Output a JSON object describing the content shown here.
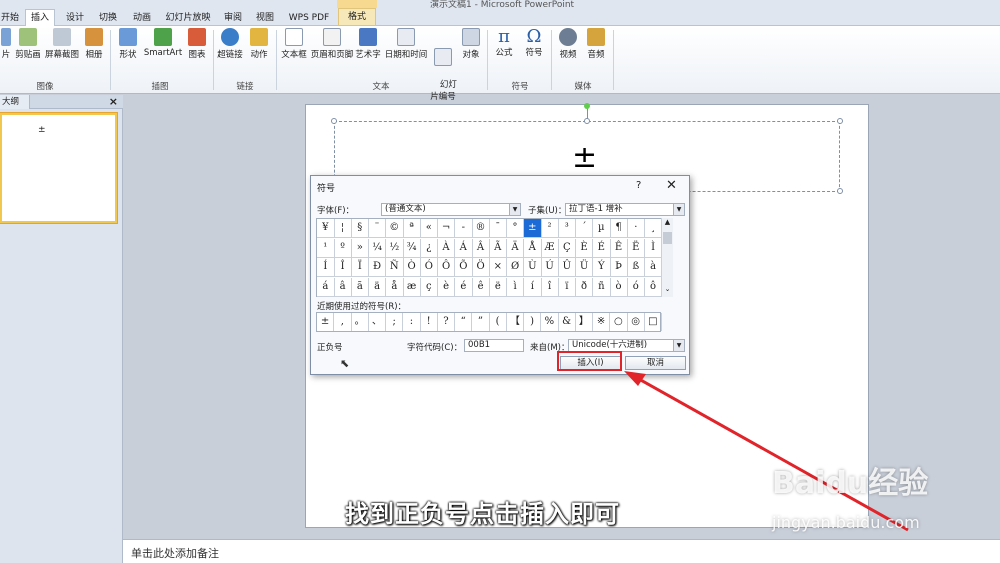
{
  "window": {
    "title": "演示文稿1 - Microsoft PowerPoint"
  },
  "tabs": [
    "开始",
    "插入",
    "设计",
    "切换",
    "动画",
    "幻灯片放映",
    "审阅",
    "视图",
    "WPS PDF",
    "格式"
  ],
  "ribbon": {
    "images_group": {
      "label": "图像",
      "buttons": [
        "片",
        "剪贴画",
        "屏幕截图",
        "相册"
      ]
    },
    "illustrations_group": {
      "label": "插图",
      "buttons": [
        "形状",
        "SmartArt",
        "图表"
      ]
    },
    "links_group": {
      "label": "链接",
      "buttons": [
        "超链接",
        "动作"
      ]
    },
    "text_group": {
      "label": "文本",
      "buttons": [
        "文本框",
        "页眉和页脚",
        "艺术字",
        "日期和时间",
        "幻灯\n片编号",
        "对象"
      ]
    },
    "symbols_group": {
      "label": "符号",
      "buttons": [
        "公式",
        "符号"
      ]
    },
    "media_group": {
      "label": "媒体",
      "buttons": [
        "视频",
        "音频"
      ]
    }
  },
  "left_pane": {
    "tab_label": "大纲",
    "close": "×",
    "thumb_symbol": "±"
  },
  "slide": {
    "symbol": "±"
  },
  "dialog": {
    "title": "符号",
    "help": "?",
    "close": "✕",
    "font_label": "字体(F)：",
    "font_value": "(普通文本)",
    "subset_label": "子集(U)：",
    "subset_value": "拉丁语-1 增补",
    "symbols": [
      [
        "¥",
        "¦",
        "§",
        "¨",
        "©",
        "ª",
        "«",
        "¬",
        "-",
        "®",
        "¯",
        "°",
        "±",
        "²",
        "³",
        "´",
        "µ",
        "¶",
        "·",
        "¸"
      ],
      [
        "¹",
        "º",
        "»",
        "¼",
        "½",
        "¾",
        "¿",
        "À",
        "Á",
        "Â",
        "Ã",
        "Ä",
        "Å",
        "Æ",
        "Ç",
        "È",
        "É",
        "Ê",
        "Ë",
        "Ì"
      ],
      [
        "Í",
        "Î",
        "Ï",
        "Ð",
        "Ñ",
        "Ò",
        "Ó",
        "Ô",
        "Õ",
        "Ö",
        "×",
        "Ø",
        "Ù",
        "Ú",
        "Û",
        "Ü",
        "Ý",
        "Þ",
        "ß",
        "à"
      ],
      [
        "á",
        "â",
        "ã",
        "ä",
        "å",
        "æ",
        "ç",
        "è",
        "é",
        "ê",
        "ë",
        "ì",
        "í",
        "î",
        "ï",
        "ð",
        "ñ",
        "ò",
        "ó",
        "ô"
      ]
    ],
    "recent_label": "近期使用过的符号(R)：",
    "recent": [
      "±",
      ",",
      "。",
      "、",
      ";",
      ":",
      "!",
      "?",
      "“",
      "”",
      "(",
      "【",
      ")",
      "%",
      "&",
      "】",
      "※",
      "○",
      "◎",
      "□"
    ],
    "char_name": "正负号",
    "code_label": "字符代码(C)：",
    "code_value": "00B1",
    "from_label": "来自(M)：",
    "from_value": "Unicode(十六进制)",
    "insert_label": "插入(I)",
    "cancel_label": "取消"
  },
  "notes_placeholder": "单击此处添加备注",
  "subtitle": "找到正负号点击插入即可",
  "watermark": {
    "main": "Baidu经验",
    "sub": "jingyan.baidu.com"
  },
  "colors": {
    "selection": "#1c6ad6",
    "highlight": "#e0242a",
    "ribbon_bg": "#dfe6f0"
  }
}
